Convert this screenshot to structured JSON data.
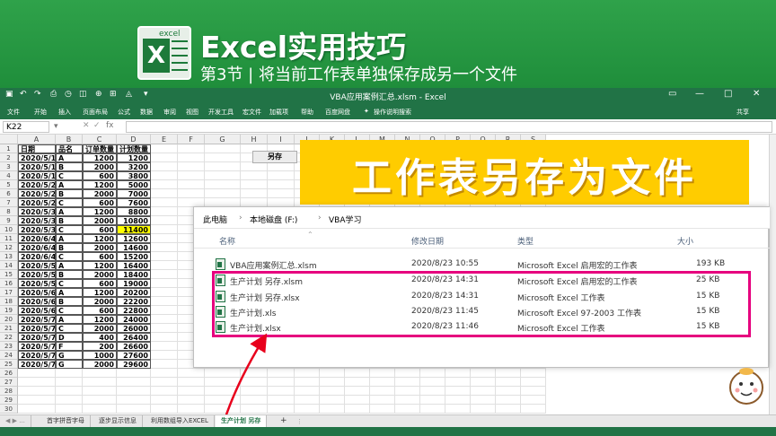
{
  "banner": {
    "logo_tag": "excel",
    "logo_letter": "X",
    "title": "Excel实用技巧",
    "subtitle": "第3节 | 将当前工作表单独保存成另一个文件"
  },
  "titlebar": {
    "title": "VBA应用案例汇总.xlsm - Excel",
    "min": "—",
    "max": "□",
    "close": "✕"
  },
  "ribbon": {
    "tabs": [
      "文件",
      "开始",
      "插入",
      "页面布局",
      "公式",
      "数据",
      "审阅",
      "视图",
      "开发工具",
      "宏文件",
      "加载项",
      "帮助",
      "百度网盘",
      "操作说明搜索"
    ],
    "share": "共享"
  },
  "formula_bar": {
    "name_box": "K22",
    "fx": "fx",
    "value": ""
  },
  "columns": [
    "A",
    "B",
    "C",
    "D",
    "E",
    "F",
    "G",
    "H",
    "I",
    "J",
    "K",
    "L",
    "M",
    "N",
    "O",
    "P",
    "Q",
    "R",
    "S"
  ],
  "headers": {
    "date": "日期",
    "name": "品名",
    "order": "订单数量",
    "plan": "计划数量"
  },
  "rows": [
    [
      "2020/5/1",
      "A",
      "1200",
      "1200"
    ],
    [
      "2020/5/1",
      "B",
      "2000",
      "3200"
    ],
    [
      "2020/5/1",
      "C",
      "600",
      "3800"
    ],
    [
      "2020/5/2",
      "A",
      "1200",
      "5000"
    ],
    [
      "2020/5/2",
      "B",
      "2000",
      "7000"
    ],
    [
      "2020/5/2",
      "C",
      "600",
      "7600"
    ],
    [
      "2020/5/3",
      "A",
      "1200",
      "8800"
    ],
    [
      "2020/5/3",
      "B",
      "2000",
      "10800"
    ],
    [
      "2020/5/3",
      "C",
      "600",
      "11400"
    ],
    [
      "2020/6/4",
      "A",
      "1200",
      "12600"
    ],
    [
      "2020/6/4",
      "B",
      "2000",
      "14600"
    ],
    [
      "2020/6/4",
      "C",
      "600",
      "15200"
    ],
    [
      "2020/5/5",
      "A",
      "1200",
      "16400"
    ],
    [
      "2020/5/5",
      "B",
      "2000",
      "18400"
    ],
    [
      "2020/5/5",
      "C",
      "600",
      "19000"
    ],
    [
      "2020/5/6",
      "A",
      "1200",
      "20200"
    ],
    [
      "2020/5/6",
      "B",
      "2000",
      "22200"
    ],
    [
      "2020/5/6",
      "C",
      "600",
      "22800"
    ],
    [
      "2020/5/7",
      "A",
      "1200",
      "24000"
    ],
    [
      "2020/5/7",
      "C",
      "2000",
      "26000"
    ],
    [
      "2020/5/7",
      "D",
      "400",
      "26400"
    ],
    [
      "2020/5/7",
      "F",
      "200",
      "26600"
    ],
    [
      "2020/5/7",
      "G",
      "1000",
      "27600"
    ],
    [
      "2020/5/7",
      "G",
      "2000",
      "29600"
    ]
  ],
  "row_numbers": [
    "1",
    "2",
    "3",
    "4",
    "5",
    "6",
    "7",
    "8",
    "9",
    "10",
    "11",
    "12",
    "13",
    "14",
    "15",
    "16",
    "17",
    "18",
    "19",
    "20",
    "21",
    "22",
    "23",
    "24",
    "25",
    "26",
    "27",
    "28",
    "29",
    "30"
  ],
  "save_button": "另存",
  "callout": "工作表另存为文件",
  "explorer": {
    "breadcrumb": [
      "此电脑",
      "本地磁盘 (F:)",
      "VBA学习"
    ],
    "col_name": "名称",
    "col_date": "修改日期",
    "col_type": "类型",
    "col_size": "大小",
    "files": [
      {
        "name": "VBA应用案例汇总.xlsm",
        "date": "2020/8/23 10:55",
        "type": "Microsoft Excel 启用宏的工作表",
        "size": "193 KB"
      },
      {
        "name": "生产计划 另存.xlsm",
        "date": "2020/8/23 14:31",
        "type": "Microsoft Excel 启用宏的工作表",
        "size": "25 KB"
      },
      {
        "name": "生产计划 另存.xlsx",
        "date": "2020/8/23 14:31",
        "type": "Microsoft Excel 工作表",
        "size": "15 KB"
      },
      {
        "name": "生产计划.xls",
        "date": "2020/8/23 11:45",
        "type": "Microsoft Excel 97-2003 工作表",
        "size": "15 KB"
      },
      {
        "name": "生产计划.xlsx",
        "date": "2020/8/23 11:46",
        "type": "Microsoft Excel 工作表",
        "size": "15 KB"
      }
    ]
  },
  "sheet_tabs": [
    "首字拼音字母",
    "逐步显示信息",
    "利用数组导入EXCEL",
    "生产计划 另存"
  ],
  "add_sheet": "+",
  "colors": {
    "excel_green": "#217346",
    "banner_green": "#2fa24a",
    "callout": "#ffcc00",
    "highlight": "#e6007e"
  }
}
